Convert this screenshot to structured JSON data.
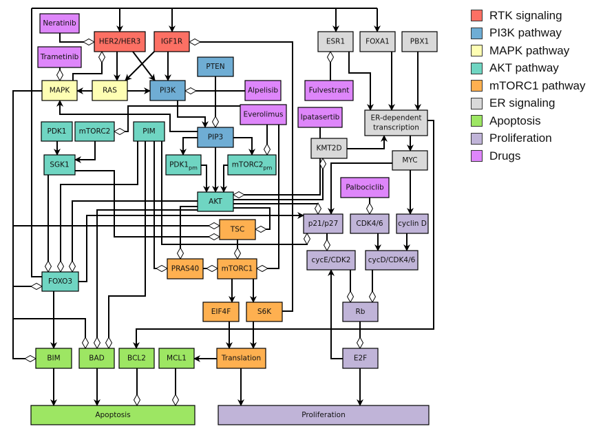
{
  "colors": {
    "rtk": "#fc7064",
    "pi3k": "#6fadd4",
    "mapk": "#fefeb3",
    "akt": "#6fd5c2",
    "mtorc1": "#feb050",
    "er": "#d9d9d9",
    "apoptosis": "#9de663",
    "proliferation": "#c0b4d8",
    "drugs": "#de86fa"
  },
  "legend": [
    {
      "label": "RTK signaling",
      "group": "rtk"
    },
    {
      "label": "PI3K pathway",
      "group": "pi3k"
    },
    {
      "label": "MAPK pathway",
      "group": "mapk"
    },
    {
      "label": "AKT pathway",
      "group": "akt"
    },
    {
      "label": "mTORC1 pathway",
      "group": "mtorc1"
    },
    {
      "label": "ER signaling",
      "group": "er"
    },
    {
      "label": "Apoptosis",
      "group": "apoptosis"
    },
    {
      "label": "Proliferation",
      "group": "proliferation"
    },
    {
      "label": "Drugs",
      "group": "drugs"
    }
  ],
  "nodes": {
    "neratinib": {
      "label": "Neratinib",
      "group": "drugs"
    },
    "her2": {
      "label": "HER2/HER3",
      "group": "rtk"
    },
    "igf1r": {
      "label": "IGF1R",
      "group": "rtk"
    },
    "trametinib": {
      "label": "Trametinib",
      "group": "drugs"
    },
    "pten": {
      "label": "PTEN",
      "group": "pi3k"
    },
    "mapk": {
      "label": "MAPK",
      "group": "mapk"
    },
    "ras": {
      "label": "RAS",
      "group": "mapk"
    },
    "pi3k": {
      "label": "PI3K",
      "group": "pi3k"
    },
    "alpelisib": {
      "label": "Alpelisib",
      "group": "drugs"
    },
    "everolimus": {
      "label": "Everolimus",
      "group": "drugs"
    },
    "pdk1": {
      "label": "PDK1",
      "group": "akt"
    },
    "mtorc2": {
      "label": "mTORC2",
      "group": "akt"
    },
    "pim": {
      "label": "PIM",
      "group": "akt"
    },
    "pip3": {
      "label": "PIP3",
      "group": "pi3k"
    },
    "pdk1pm": {
      "label": "PDK1",
      "sub": "pm",
      "group": "akt"
    },
    "mtorc2pm": {
      "label": "mTORC2",
      "sub": "pm",
      "group": "akt"
    },
    "sgk1": {
      "label": "SGK1",
      "group": "akt"
    },
    "akt": {
      "label": "AKT",
      "group": "akt"
    },
    "tsc": {
      "label": "TSC",
      "group": "mtorc1"
    },
    "pras40": {
      "label": "PRAS40",
      "group": "mtorc1"
    },
    "mtorc1": {
      "label": "mTORC1",
      "group": "mtorc1"
    },
    "foxo3": {
      "label": "FOXO3",
      "group": "akt"
    },
    "eif4f": {
      "label": "EIF4F",
      "group": "mtorc1"
    },
    "s6k": {
      "label": "S6K",
      "group": "mtorc1"
    },
    "bim": {
      "label": "BIM",
      "group": "apoptosis"
    },
    "bad": {
      "label": "BAD",
      "group": "apoptosis"
    },
    "bcl2": {
      "label": "BCL2",
      "group": "apoptosis"
    },
    "mcl1": {
      "label": "MCL1",
      "group": "apoptosis"
    },
    "translation": {
      "label": "Translation",
      "group": "mtorc1"
    },
    "apoptosis": {
      "label": "Apoptosis",
      "group": "apoptosis"
    },
    "proliferation": {
      "label": "Proliferation",
      "group": "proliferation"
    },
    "esr1": {
      "label": "ESR1",
      "group": "er"
    },
    "foxa1": {
      "label": "FOXA1",
      "group": "er"
    },
    "pbx1": {
      "label": "PBX1",
      "group": "er"
    },
    "fulvestrant": {
      "label": "Fulvestrant",
      "group": "drugs"
    },
    "ipatasertib": {
      "label": "Ipatasertib",
      "group": "drugs"
    },
    "erdep": {
      "label": "ER-dependent",
      "label2": "transcription",
      "group": "er"
    },
    "kmt2d": {
      "label": "KMT2D",
      "group": "er"
    },
    "myc": {
      "label": "MYC",
      "group": "er"
    },
    "palbociclib": {
      "label": "Palbociclib",
      "group": "drugs"
    },
    "p21": {
      "label": "p21/p27",
      "group": "proliferation"
    },
    "cdk46": {
      "label": "CDK4/6",
      "group": "proliferation"
    },
    "cyclind": {
      "label": "cyclin D",
      "group": "proliferation"
    },
    "cyce": {
      "label": "cycE/CDK2",
      "group": "proliferation"
    },
    "cycd": {
      "label": "cycD/CDK4/6",
      "group": "proliferation"
    },
    "rb": {
      "label": "Rb",
      "group": "proliferation"
    },
    "e2f": {
      "label": "E2F",
      "group": "proliferation"
    }
  }
}
